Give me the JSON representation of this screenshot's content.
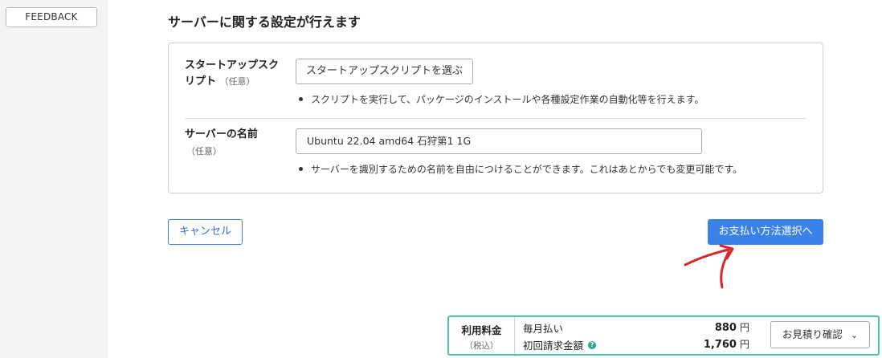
{
  "feedback": {
    "label": "FEEDBACK"
  },
  "heading": "サーバーに関する設定が行えます",
  "startup_script": {
    "label_line1": "スタートアップスク",
    "label_line2": "リプト",
    "optional": "（任意）",
    "button": "スタートアップスクリプトを選ぶ",
    "description": "スクリプトを実行して、パッケージのインストールや各種設定作業の自動化等を行えます。"
  },
  "server_name": {
    "label": "サーバーの名前",
    "optional": "（任意）",
    "value": "Ubuntu 22.04 amd64 石狩第1 1G",
    "description": "サーバーを識別するための名前を自由につけることができます。これはあとからでも変更可能です。"
  },
  "actions": {
    "cancel": "キャンセル",
    "next": "お支払い方法選択へ"
  },
  "price": {
    "label": "利用料金",
    "tax_note": "（税込）",
    "monthly_label": "毎月払い",
    "monthly_value": "880",
    "initial_label": "初回請求金額",
    "initial_value": "1,760",
    "currency": "円",
    "help_icon": "?",
    "estimate_button": "お見積り確認",
    "chevron": "⌄"
  },
  "colors": {
    "primary": "#3b82e8",
    "price_border": "#4cc3a6",
    "annotation": "#d8262a"
  }
}
